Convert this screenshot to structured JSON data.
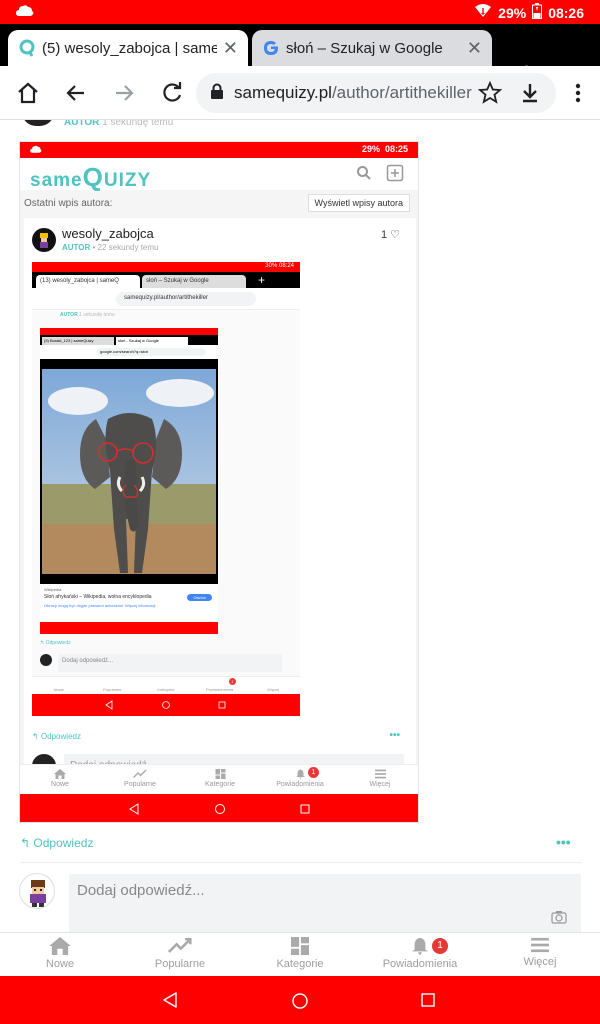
{
  "status_bar": {
    "battery": "29%",
    "time": "08:26"
  },
  "tabs": [
    {
      "title": "(5) wesoly_zabojca | sameQuizy",
      "active": true
    },
    {
      "title": "słoń – Szukaj w Google",
      "active": false
    }
  ],
  "toolbar": {
    "url_host": "samequizy.pl",
    "url_path": "/author/artithekiller"
  },
  "page": {
    "partial_author_label": "AUTOR",
    "partial_time": "1 sekundę temu",
    "embedded": {
      "status": {
        "battery": "29%",
        "time": "08:25"
      },
      "logo": {
        "prefix": "same",
        "big": "Q",
        "suffix": "UIZY"
      },
      "section_label": "Ostatni wpis autora:",
      "see_posts_button": "Wyświetl wpisy autora",
      "author_name": "wesoly_zabojca",
      "author_label": "AUTOR",
      "author_time": "22 sekundy temu",
      "likes": "1",
      "nested": {
        "status": {
          "battery": "30%",
          "time": "08:24"
        },
        "tab1": "(13) wesoly_zabojca | sameQ",
        "tab2": "słoń – Szukaj w Google",
        "url": "samequizy.pl/author/artithekiller",
        "partial_label": "AUTOR",
        "partial_time": "1 sekundę temu",
        "inner": {
          "tab1": "(5) Buraki_123 | sameQuizy",
          "tab2": "słoń - Szukaj w Google",
          "url": "google.com/search?q=słoń",
          "result_source": "Wikipedia",
          "result_title": "Słoń afrykański – Wikipedia, wolna encyklopedia",
          "result_sub": "Obrazy mogą być objęte prawami autorskimi. Więcej informacji",
          "visit_button": "Otwórz"
        },
        "reply": "Odpowiedz",
        "add_reply": "Dodaj odpowiedź...",
        "nav": [
          "Nowe",
          "Popularne",
          "Kategorie",
          "Powiadomienia",
          "Więcej"
        ],
        "notif_badge": "1"
      },
      "reply": "Odpowiedz",
      "add_reply": "Dodaj odpowiedź",
      "nav": [
        "Nowe",
        "Popularne",
        "Kategorie",
        "Powiadomienia",
        "Więcej"
      ],
      "notif_badge": "1"
    },
    "reply_label": "Odpowiedz",
    "comment_placeholder": "Dodaj odpowiedź..."
  },
  "bottom_nav": {
    "items": [
      {
        "label": "Nowe",
        "icon": "home-icon"
      },
      {
        "label": "Popularne",
        "icon": "trending-icon"
      },
      {
        "label": "Kategorie",
        "icon": "grid-icon"
      },
      {
        "label": "Powiadomienia",
        "icon": "bell-icon"
      },
      {
        "label": "Więcej",
        "icon": "menu-icon"
      }
    ],
    "notif_badge": "1"
  },
  "colors": {
    "accent": "#4ec3c0",
    "system_red": "#ff0000",
    "badge_red": "#e53935"
  }
}
